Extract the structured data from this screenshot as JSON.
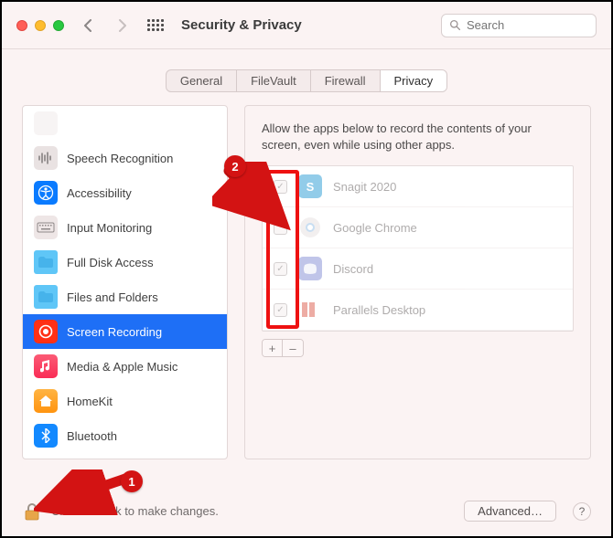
{
  "header": {
    "title": "Security & Privacy",
    "search_placeholder": "Search"
  },
  "tabs": [
    "General",
    "FileVault",
    "Firewall",
    "Privacy"
  ],
  "tabs_active_index": 3,
  "sidebar": {
    "items": [
      {
        "label": "Speech Recognition",
        "icon": "speech"
      },
      {
        "label": "Accessibility",
        "icon": "accessibility"
      },
      {
        "label": "Input Monitoring",
        "icon": "keyboard"
      },
      {
        "label": "Full Disk Access",
        "icon": "disk"
      },
      {
        "label": "Files and Folders",
        "icon": "folder"
      },
      {
        "label": "Screen Recording",
        "icon": "record",
        "selected": true
      },
      {
        "label": "Media & Apple Music",
        "icon": "music"
      },
      {
        "label": "HomeKit",
        "icon": "home"
      },
      {
        "label": "Bluetooth",
        "icon": "bluetooth"
      }
    ]
  },
  "detail": {
    "description": "Allow the apps below to record the contents of your screen, even while using other apps.",
    "apps": [
      {
        "name": "Snagit 2020",
        "checked": true,
        "icon": "snagit"
      },
      {
        "name": "Google Chrome",
        "checked": false,
        "icon": "chrome"
      },
      {
        "name": "Discord",
        "checked": true,
        "icon": "discord"
      },
      {
        "name": "Parallels Desktop",
        "checked": true,
        "icon": "parallels"
      }
    ],
    "plus": "+",
    "minus": "–"
  },
  "footer": {
    "lock_text": "Click the lock to make changes.",
    "advanced": "Advanced…",
    "help": "?"
  },
  "annotations": {
    "badge1": "1",
    "badge2": "2"
  }
}
